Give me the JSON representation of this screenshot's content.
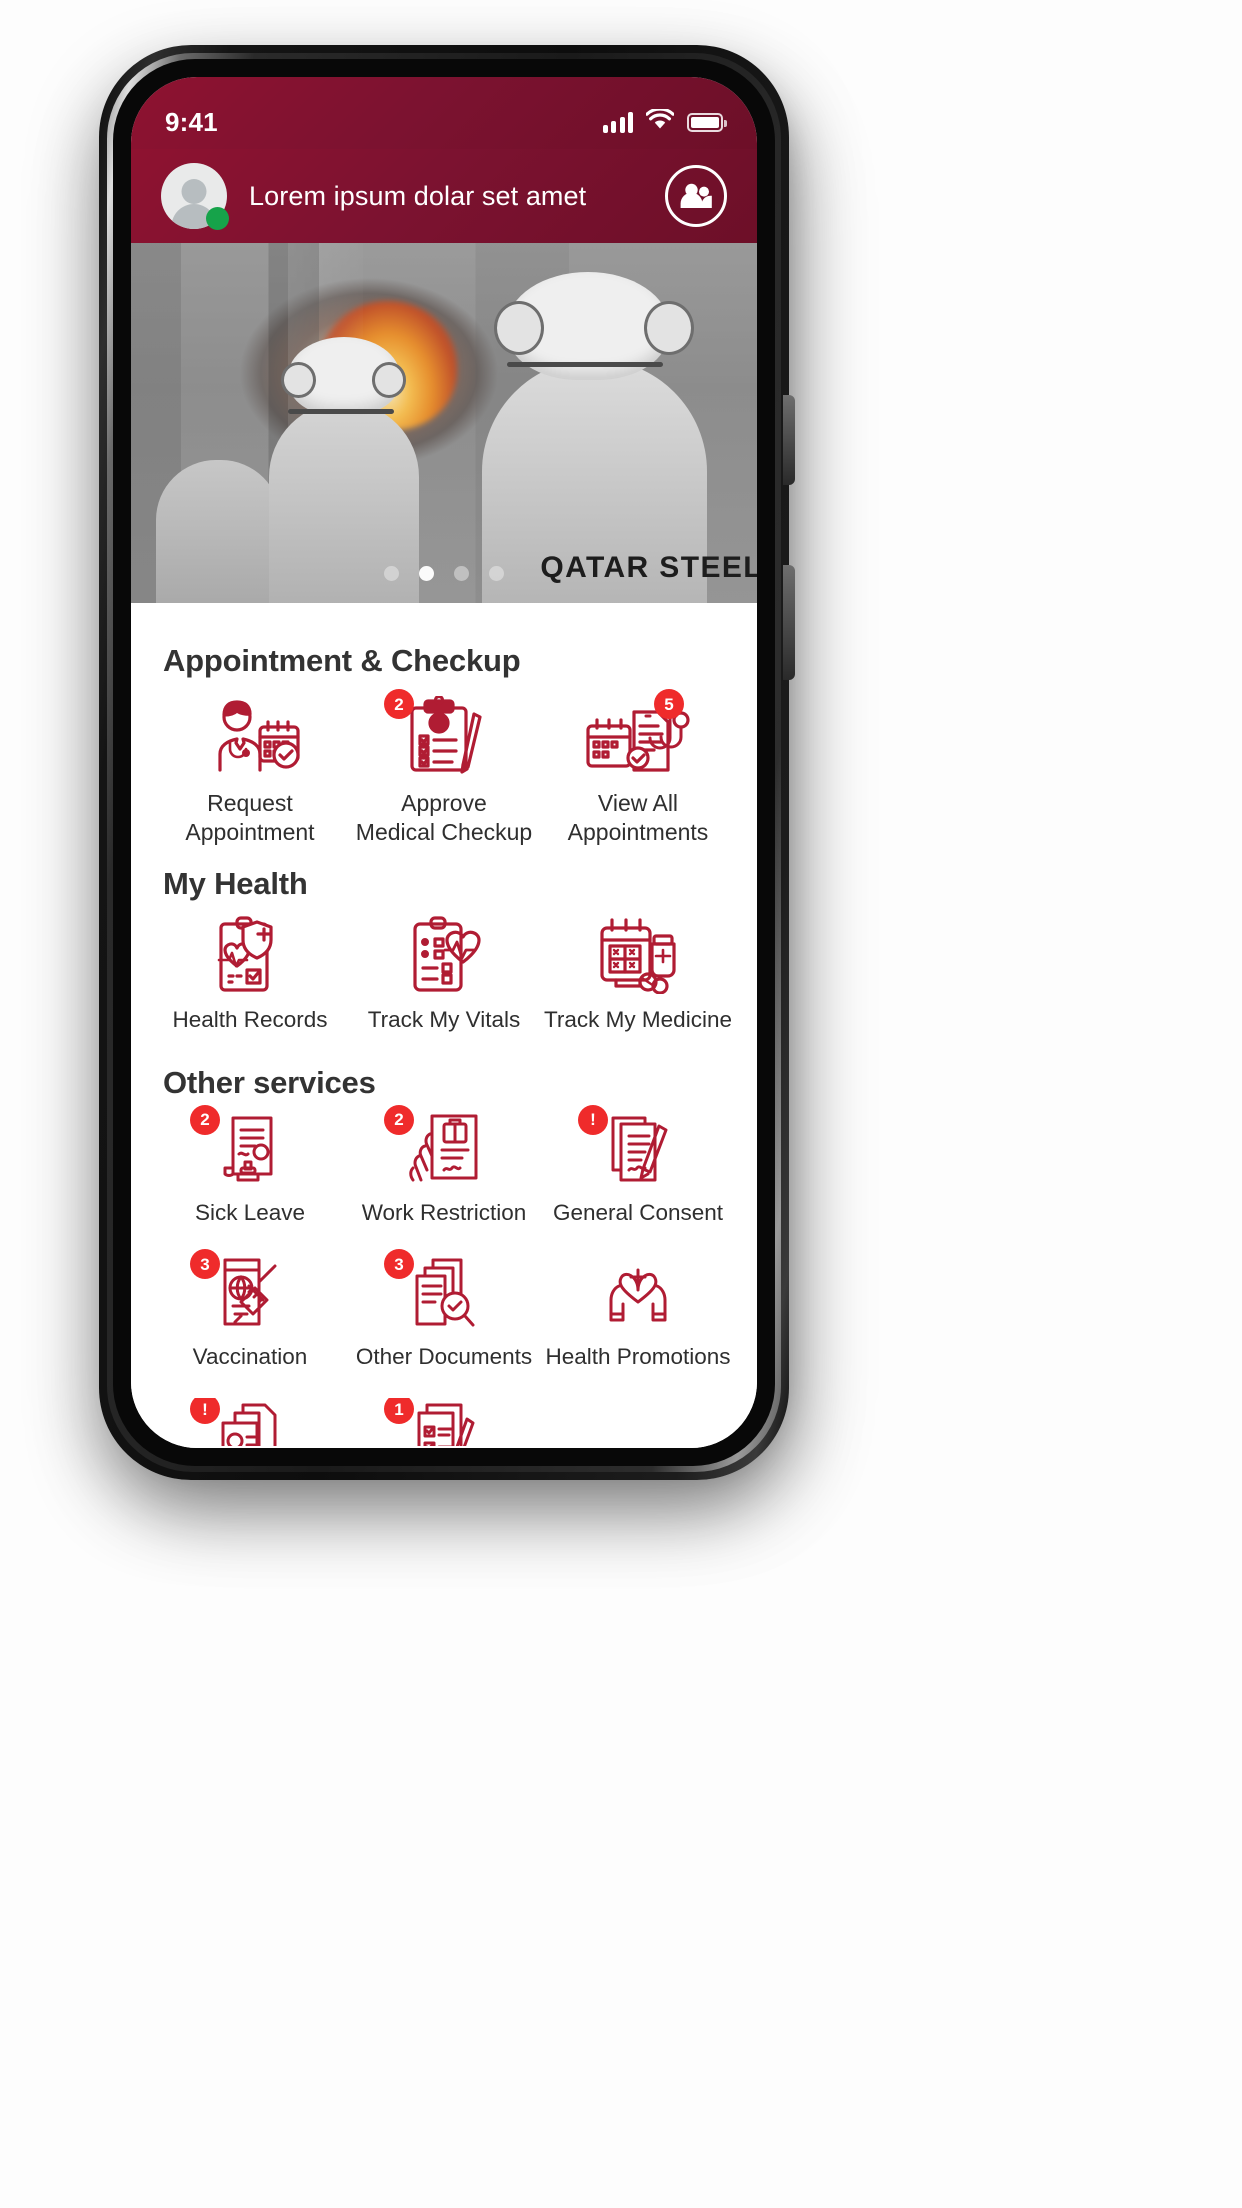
{
  "status_bar": {
    "time": "9:41",
    "signal_icon": "signal-bars-icon",
    "wifi_icon": "wifi-icon",
    "battery_icon": "battery-full-icon"
  },
  "header": {
    "user_name": "Lorem ipsum dolar set amet",
    "avatar_icon": "avatar-placeholder-icon",
    "online_status": "online",
    "people_button_icon": "people-group-icon",
    "background_color": "#7c1230"
  },
  "hero": {
    "brand_text": "QATAR STEEL",
    "slide_count": 4,
    "active_slide": 2
  },
  "theme": {
    "primary_red": "#7c1230",
    "icon_red": "#b01c33",
    "badge_red": "#ef2b2b",
    "online_green": "#16a34a",
    "heading_color": "#333333"
  },
  "sections": [
    {
      "title": "Appointment & Checkup",
      "items": [
        {
          "label": "Request\nAppointment",
          "label_line1": "Request",
          "label_line2": "Appointment",
          "icon": "doctor-calendar-check-icon",
          "badge": null
        },
        {
          "label": "Approve\nMedical Checkup",
          "label_line1": "Approve",
          "label_line2": "Medical Checkup",
          "icon": "clipboard-checklist-pen-icon",
          "badge": "2"
        },
        {
          "label": "View All\nAppointments",
          "label_line1": "View All",
          "label_line2": "Appointments",
          "icon": "calendar-records-stethoscope-icon",
          "badge": "5"
        }
      ]
    },
    {
      "title": "My Health",
      "items": [
        {
          "label": "Health Records",
          "icon": "health-record-shield-heart-icon",
          "badge": null
        },
        {
          "label": "Track My Vitals",
          "icon": "clipboard-heartbeat-icon",
          "badge": null
        },
        {
          "label": "Track My Medicine",
          "icon": "medicine-calendar-pills-icon",
          "badge": null
        }
      ]
    },
    {
      "title": "Other services",
      "items": [
        {
          "label": "Sick Leave",
          "icon": "certificate-stamp-icon",
          "badge": "2"
        },
        {
          "label": "Work Restriction",
          "icon": "hand-briefcase-document-icon",
          "badge": "2"
        },
        {
          "label": "General Consent",
          "icon": "consent-documents-pen-icon",
          "badge": "!"
        },
        {
          "label": "Vaccination",
          "icon": "vaccine-passport-syringe-icon",
          "badge": "3"
        },
        {
          "label": "Other Documents",
          "icon": "documents-search-check-icon",
          "badge": "3"
        },
        {
          "label": "Health Promotions",
          "icon": "hands-heart-cross-icon",
          "badge": null
        },
        {
          "label": "",
          "icon": "id-card-documents-icon",
          "badge": "!"
        },
        {
          "label": "",
          "icon": "checklist-pen-icon",
          "badge": "1"
        }
      ]
    }
  ]
}
